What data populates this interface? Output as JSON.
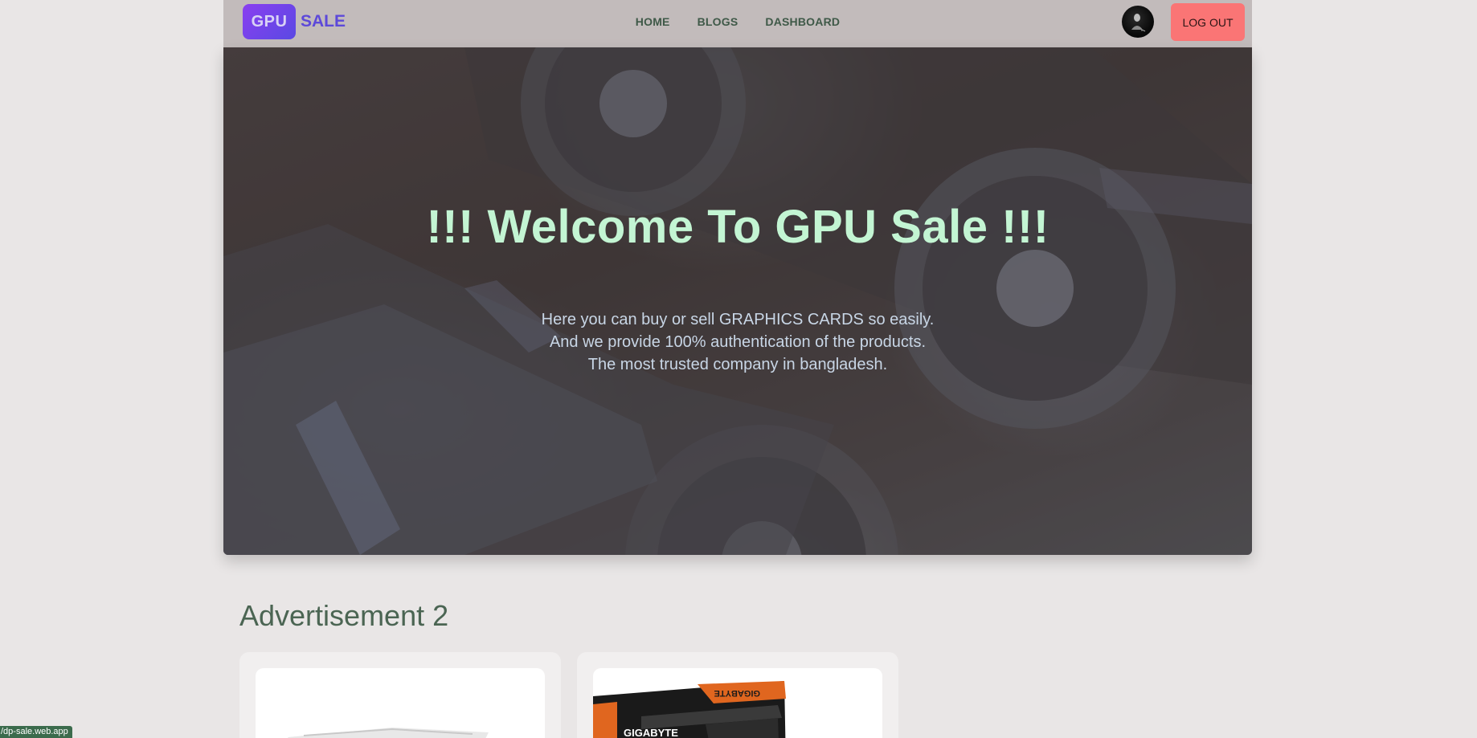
{
  "navbar": {
    "logo_badge": "GPU",
    "logo_text": "SALE",
    "links": {
      "home": "HOME",
      "blogs": "BLOGS",
      "dashboard": "DASHBOARD"
    },
    "logout_label": "LOG OUT"
  },
  "hero": {
    "title": "!!! Welcome To GPU Sale !!!",
    "lines": [
      "Here you can buy or sell GRAPHICS CARDS so easily.",
      "And we provide 100% authentication of the products.",
      "The most trusted company in bangladesh."
    ]
  },
  "ads": {
    "heading": "Advertisement 2",
    "card2_brand": "GIGABYTE",
    "card2_brand_top": "GIGABYTE"
  },
  "status_bar": {
    "url": "/dp-sale.web.app"
  },
  "colors": {
    "navbar_bg": "#c2bbbb",
    "logo_gradient_start": "#8a3ff0",
    "logo_text": "#5d49d9",
    "nav_link": "#3f5948",
    "logout_bg": "#fa7575",
    "hero_title": "#c3f5d3",
    "hero_text": "#c8d6e6",
    "heading": "#4b6553",
    "page_bg": "#e9e6e6"
  }
}
